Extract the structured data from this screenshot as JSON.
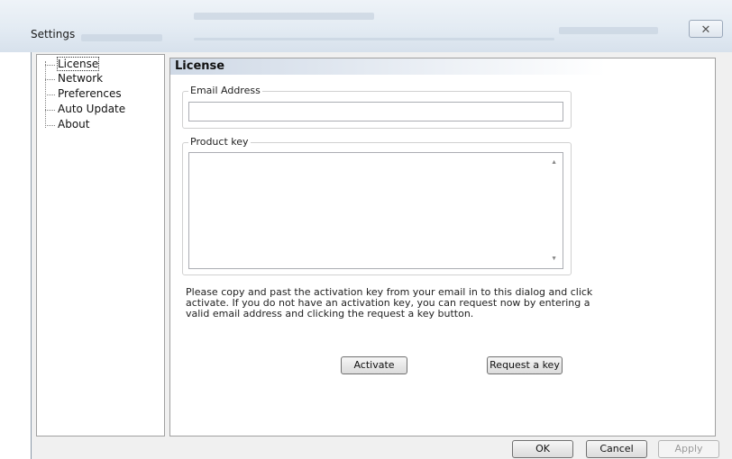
{
  "window": {
    "title": "Settings",
    "close_glyph": "✕"
  },
  "sidebar": {
    "items": [
      {
        "label": "License",
        "selected": true
      },
      {
        "label": "Network"
      },
      {
        "label": "Preferences"
      },
      {
        "label": "Auto Update"
      },
      {
        "label": "About"
      }
    ]
  },
  "panel": {
    "heading": "License",
    "email": {
      "label": "Email Address",
      "value": ""
    },
    "product_key": {
      "label": "Product key",
      "value": ""
    },
    "instructions": "Please copy and past the activation key from your email in to this dialog and click activate. If you do not have an activation key, you can request now by entering a valid email address and clicking the request a key button.",
    "activate_label": "Activate",
    "request_label": "Request a key"
  },
  "footer": {
    "ok_label": "OK",
    "cancel_label": "Cancel",
    "apply_label": "Apply"
  },
  "icons": {
    "scroll_up": "▲",
    "scroll_down": "▼"
  }
}
